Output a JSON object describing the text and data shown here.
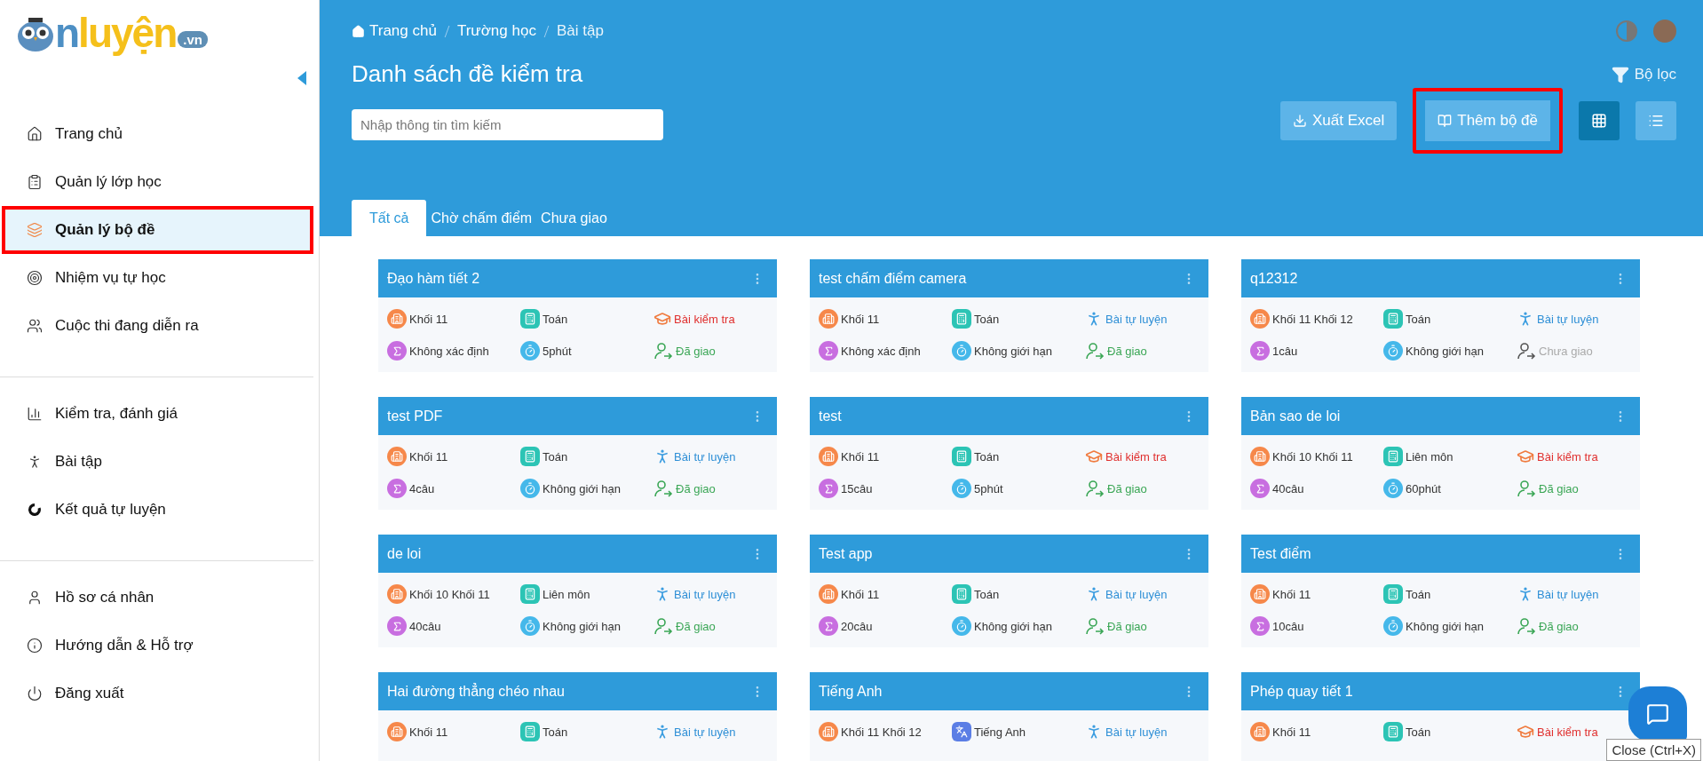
{
  "logo": {
    "lead": "n",
    "main": "luyện",
    "suffix": ".vn"
  },
  "sidebar": {
    "groups": [
      {
        "items": [
          {
            "label": "Trang chủ",
            "selected": false,
            "highlighted": false
          },
          {
            "label": "Quản lý lớp học",
            "selected": false,
            "highlighted": false
          },
          {
            "label": "Quản lý bộ đề",
            "selected": true,
            "highlighted": true
          },
          {
            "label": "Nhiệm vụ tự học",
            "selected": false,
            "highlighted": false
          },
          {
            "label": "Cuộc thi đang diễn ra",
            "selected": false,
            "highlighted": false
          }
        ]
      },
      {
        "items": [
          {
            "label": "Kiểm tra, đánh giá",
            "selected": false,
            "highlighted": false
          },
          {
            "label": "Bài tập",
            "selected": false,
            "highlighted": false
          },
          {
            "label": "Kết quả tự luyện",
            "selected": false,
            "highlighted": false
          }
        ]
      },
      {
        "items": [
          {
            "label": "Hồ sơ cá nhân",
            "selected": false,
            "highlighted": false
          },
          {
            "label": "Hướng dẫn & Hỗ trợ",
            "selected": false,
            "highlighted": false
          },
          {
            "label": "Đăng xuất",
            "selected": false,
            "highlighted": false
          }
        ]
      }
    ]
  },
  "breadcrumb": [
    "Trang chủ",
    "Trường học",
    "Bài tập"
  ],
  "page_title": "Danh sách đề kiểm tra",
  "filter_label": "Bộ lọc",
  "search": {
    "placeholder": "Nhập thông tin tìm kiếm"
  },
  "actions": [
    {
      "label": "Xuất Excel",
      "highlighted": false
    },
    {
      "label": "Thêm bộ đề",
      "highlighted": true
    }
  ],
  "view_buttons": [
    {
      "selected": true
    },
    {
      "selected": false
    }
  ],
  "tabs": [
    {
      "label": "Tất cả",
      "selected": true
    },
    {
      "label": "Chờ chấm điểm",
      "selected": false
    },
    {
      "label": "Chưa giao",
      "selected": false
    }
  ],
  "cards": [
    {
      "title": "Đạo hàm tiết 2",
      "grade": "Khối 11",
      "subject": {
        "kind": "math",
        "text": "Toán"
      },
      "type": {
        "kind": "exam",
        "text": "Bài kiểm tra"
      },
      "count": "Không xác định",
      "time": "5phút",
      "status": {
        "assigned": true,
        "text": "Đã giao"
      }
    },
    {
      "title": "test chấm điểm camera",
      "grade": "Khối 11",
      "subject": {
        "kind": "math",
        "text": "Toán"
      },
      "type": {
        "kind": "practice",
        "text": "Bài tự luyện"
      },
      "count": "Không xác định",
      "time": "Không giới hạn",
      "status": {
        "assigned": true,
        "text": "Đã giao"
      }
    },
    {
      "title": "q12312",
      "grade": "Khối 11 Khối 12",
      "subject": {
        "kind": "math",
        "text": "Toán"
      },
      "type": {
        "kind": "practice",
        "text": "Bài tự luyện"
      },
      "count": "1câu",
      "time": "Không giới hạn",
      "status": {
        "assigned": false,
        "text": "Chưa giao"
      }
    },
    {
      "title": "test PDF",
      "grade": "Khối 11",
      "subject": {
        "kind": "math",
        "text": "Toán"
      },
      "type": {
        "kind": "practice",
        "text": "Bài tự luyện"
      },
      "count": "4câu",
      "time": "Không giới hạn",
      "status": {
        "assigned": true,
        "text": "Đã giao"
      }
    },
    {
      "title": "test",
      "grade": "Khối 11",
      "subject": {
        "kind": "math",
        "text": "Toán"
      },
      "type": {
        "kind": "exam",
        "text": "Bài kiểm tra"
      },
      "count": "15câu",
      "time": "5phút",
      "status": {
        "assigned": true,
        "text": "Đã giao"
      }
    },
    {
      "title": "Bản sao de loi",
      "grade": "Khối 10 Khối 11",
      "subject": {
        "kind": "math",
        "text": "Liên môn"
      },
      "type": {
        "kind": "exam",
        "text": "Bài kiểm tra"
      },
      "count": "40câu",
      "time": "60phút",
      "status": {
        "assigned": true,
        "text": "Đã giao"
      }
    },
    {
      "title": "de loi",
      "grade": "Khối 10 Khối 11",
      "subject": {
        "kind": "math",
        "text": "Liên môn"
      },
      "type": {
        "kind": "practice",
        "text": "Bài tự luyện"
      },
      "count": "40câu",
      "time": "Không giới hạn",
      "status": {
        "assigned": true,
        "text": "Đã giao"
      }
    },
    {
      "title": "Test app",
      "grade": "Khối 11",
      "subject": {
        "kind": "math",
        "text": "Toán"
      },
      "type": {
        "kind": "practice",
        "text": "Bài tự luyện"
      },
      "count": "20câu",
      "time": "Không giới hạn",
      "status": {
        "assigned": true,
        "text": "Đã giao"
      }
    },
    {
      "title": "Test điểm",
      "grade": "Khối 11",
      "subject": {
        "kind": "math",
        "text": "Toán"
      },
      "type": {
        "kind": "practice",
        "text": "Bài tự luyện"
      },
      "count": "10câu",
      "time": "Không giới hạn",
      "status": {
        "assigned": true,
        "text": "Đã giao"
      }
    },
    {
      "title": "Hai đường thẳng chéo nhau",
      "grade": "Khối 11",
      "subject": {
        "kind": "math",
        "text": "Toán"
      },
      "type": {
        "kind": "practice",
        "text": "Bài tự luyện"
      }
    },
    {
      "title": "Tiếng Anh",
      "grade": "Khối 11 Khối 12",
      "subject": {
        "kind": "language",
        "text": "Tiếng Anh"
      },
      "type": {
        "kind": "practice",
        "text": "Bài tự luyện"
      }
    },
    {
      "title": "Phép quay tiết 1",
      "grade": "Khối 11",
      "subject": {
        "kind": "math",
        "text": "Toán"
      },
      "type": {
        "kind": "exam",
        "text": "Bài kiểm tra"
      }
    }
  ],
  "tooltip": "Close (Ctrl+X)"
}
